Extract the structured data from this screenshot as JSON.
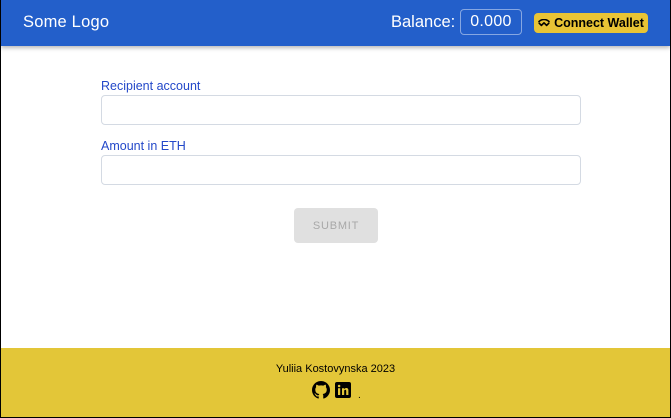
{
  "header": {
    "logo": "Some Logo",
    "balance_label": "Balance:",
    "balance_value": "0.000",
    "connect_label": "Connect Wallet"
  },
  "form": {
    "recipient_label": "Recipient account",
    "recipient_value": "",
    "amount_label": "Amount in ETH",
    "amount_value": "",
    "submit_label": "SUBMIT"
  },
  "footer": {
    "copyright": "Yuliia Kostovynska 2023",
    "links": [
      {
        "icon": "github-icon"
      },
      {
        "icon": "linkedin-icon"
      }
    ],
    "trailing": "."
  },
  "colors": {
    "header": "#235fca",
    "accent": "#e3c638",
    "label": "#2348c9",
    "disabled_button": "#e0e0e0"
  }
}
